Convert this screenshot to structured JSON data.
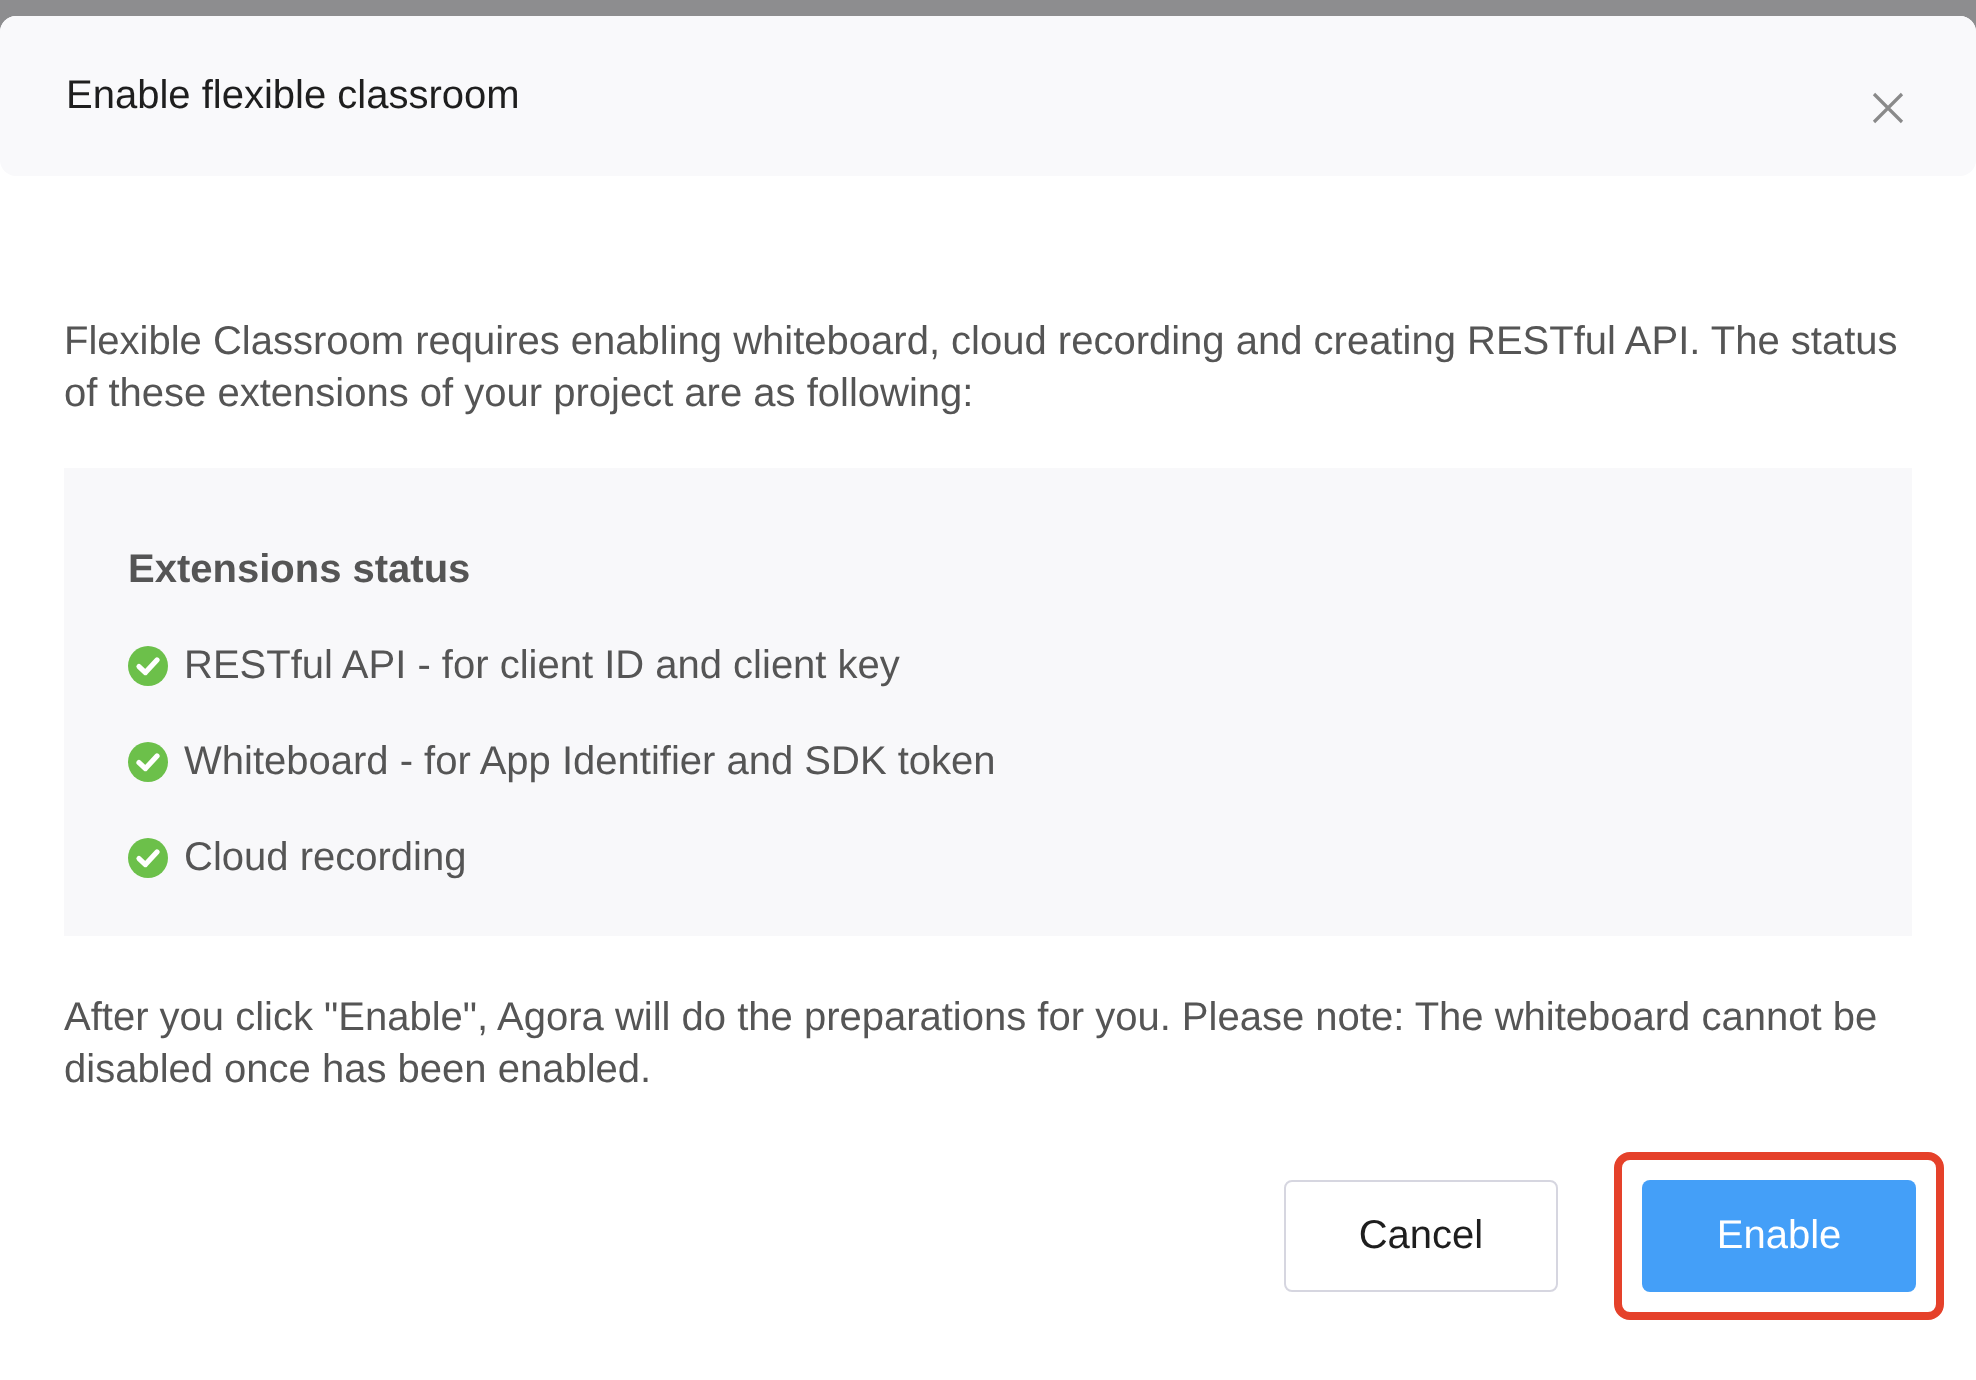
{
  "dialog": {
    "title": "Enable flexible classroom",
    "intro": "Flexible Classroom requires enabling whiteboard, cloud recording and creating RESTful API. The status of these extensions of your project are as following:",
    "status_panel": {
      "heading": "Extensions status",
      "items": [
        {
          "label": "RESTful API - for client ID and client key",
          "enabled": true
        },
        {
          "label": "Whiteboard - for App Identifier and SDK token",
          "enabled": true
        },
        {
          "label": "Cloud recording",
          "enabled": true
        }
      ]
    },
    "note": "After you click \"Enable\", Agora will do the preparations for you. Please note: The whiteboard cannot be disabled once has been enabled.",
    "buttons": [
      {
        "label": "Cancel",
        "kind": "secondary",
        "highlighted": false
      },
      {
        "label": "Enable",
        "kind": "primary",
        "highlighted": true
      }
    ]
  }
}
